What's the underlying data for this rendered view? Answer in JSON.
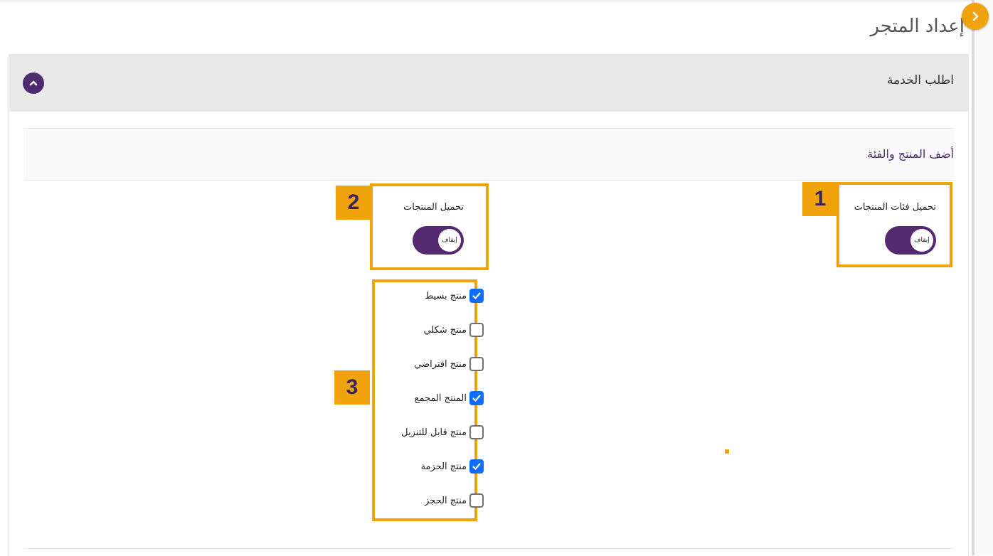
{
  "page": {
    "title": "إعداد المتجر"
  },
  "panel": {
    "title": "اطلب الخدمة"
  },
  "section": {
    "title": "أضف المنتج والفئة"
  },
  "toggles": [
    {
      "badge": "1",
      "label": "تحميل فئات المنتجات",
      "state_text": "إيقاف"
    },
    {
      "badge": "2",
      "label": "تحميل المنتجات",
      "state_text": "إيقاف"
    }
  ],
  "product_types": {
    "badge": "3",
    "items": [
      {
        "label": "منتج بسيط",
        "checked": true
      },
      {
        "label": "منتج شكلي",
        "checked": false
      },
      {
        "label": "منتج افتراضي",
        "checked": false
      },
      {
        "label": "المنتج المجمع",
        "checked": true
      },
      {
        "label": "منتج قابل للتنزيل",
        "checked": false
      },
      {
        "label": "منتج الحزمة",
        "checked": true
      },
      {
        "label": "منتج الحجز",
        "checked": false
      }
    ]
  },
  "colors": {
    "accent": "#f0a30a",
    "brand": "#55296f",
    "checkbox": "#0d6efd"
  },
  "icons": {
    "sidebar_toggle": "chevron-right-icon",
    "collapse": "chevron-up-icon",
    "check": "check-icon"
  }
}
